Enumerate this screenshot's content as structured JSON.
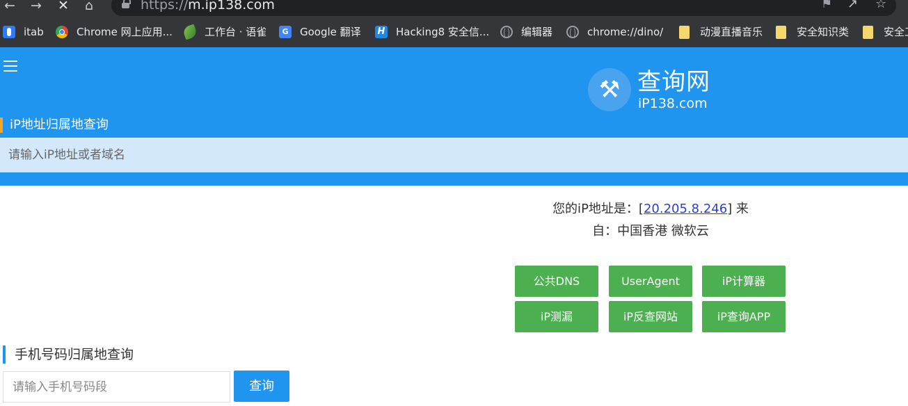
{
  "browser": {
    "url_prefix": "https://",
    "url_host": "m.ip138.com",
    "bookmarks": [
      {
        "label": "itab",
        "icon": "itab-icon"
      },
      {
        "label": "Chrome 网上应用...",
        "icon": "chrome-web-store-icon"
      },
      {
        "label": "工作台 · 语雀",
        "icon": "yuque-icon"
      },
      {
        "label": "Google 翻译",
        "icon": "google-translate-icon"
      },
      {
        "label": "Hacking8 安全信...",
        "icon": "hacking8-icon"
      },
      {
        "label": "编辑器",
        "icon": "globe-icon"
      },
      {
        "label": "chrome://dino/",
        "icon": "globe-icon"
      },
      {
        "label": "动漫直播音乐",
        "icon": "folder-icon"
      },
      {
        "label": "安全知识类",
        "icon": "folder-icon"
      },
      {
        "label": "安全工",
        "icon": "folder-icon"
      }
    ]
  },
  "header": {
    "logo_name": "查询网",
    "logo_domain": "iP138.com",
    "ip_section_title": "iP地址归属地查询",
    "ip_input_placeholder": "请输入iP地址或者域名"
  },
  "result": {
    "prefix": "您的iP地址是：[",
    "ip": "20.205.8.246",
    "suffix": "] 来",
    "location": "自：中国香港 微软云"
  },
  "tools": [
    {
      "label": "公共DNS"
    },
    {
      "label": "UserAgent"
    },
    {
      "label": "iP计算器"
    },
    {
      "label": "iP测漏"
    },
    {
      "label": "iP反查网站"
    },
    {
      "label": "iP查询APP"
    }
  ],
  "phone": {
    "title": "手机号码归属地查询",
    "input_placeholder": "请输入手机号码段",
    "query_label": "查询"
  },
  "colors": {
    "primary": "#2095ef",
    "accent": "#f5a623",
    "tool_button": "#4caf50",
    "link": "#2b3fd6"
  }
}
